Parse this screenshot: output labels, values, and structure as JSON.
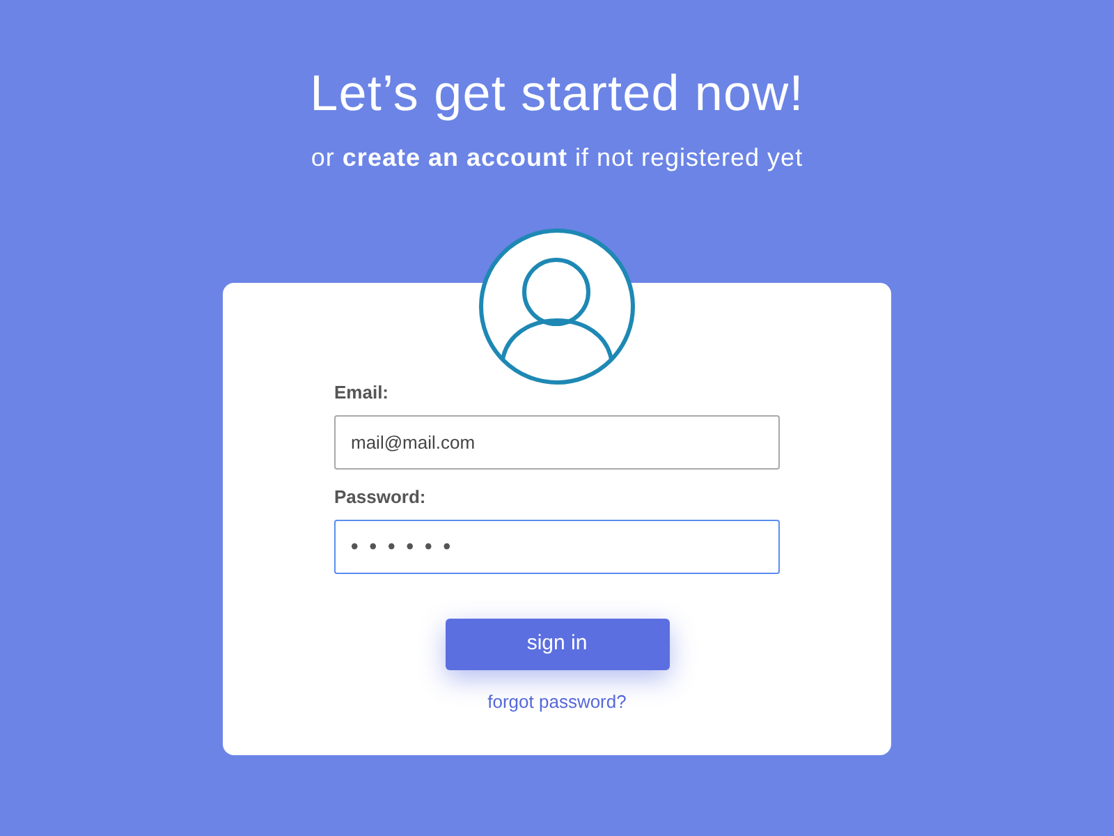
{
  "header": {
    "title": "Let’s get started now!",
    "subtitle": {
      "before": "or",
      "link": "create an account",
      "after": "if not registered yet"
    }
  },
  "form": {
    "fields": [
      {
        "kind": "email",
        "label": "Email:",
        "value": "mail@mail.com",
        "focused": false
      },
      {
        "kind": "password",
        "label": "Password:",
        "value": "••••••",
        "focused": true
      }
    ],
    "submit_button": "sign in",
    "forgot_link": "forgot password?"
  }
}
